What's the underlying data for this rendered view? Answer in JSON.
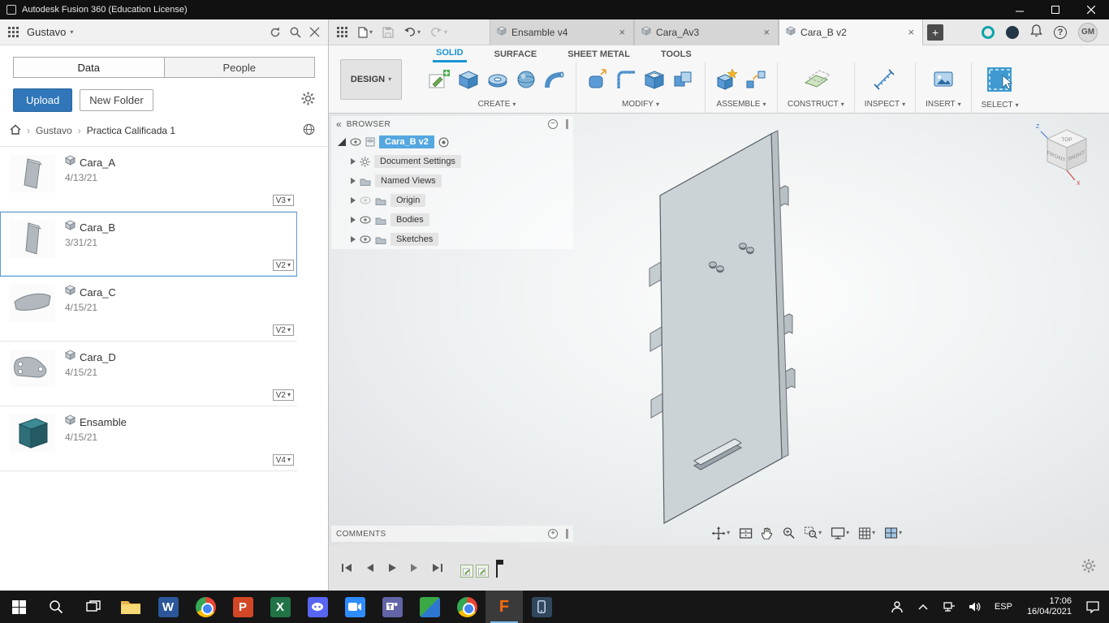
{
  "icons": {
    "caret_down": "▾",
    "close": "×",
    "plus": "+",
    "minus": "−",
    "breadcrumb_sep": "›",
    "collapse": "«",
    "help": "?"
  },
  "colors": {
    "accent_blue": "#1a94d4",
    "selection_blue": "#5b9bd5",
    "upload_blue": "#3076b8",
    "fusion_orange": "#ff6b0b"
  },
  "titlebar": {
    "title": "Autodesk Fusion 360 (Education License)"
  },
  "data_panel": {
    "account": "Gustavo",
    "tabs": [
      "Data",
      "People"
    ],
    "upload_label": "Upload",
    "new_folder_label": "New Folder",
    "breadcrumb": [
      "Gustavo",
      "Practica Calificada 1"
    ],
    "items": [
      {
        "name": "Cara_A",
        "date": "4/13/21",
        "version": "V3"
      },
      {
        "name": "Cara_B",
        "date": "3/31/21",
        "version": "V2"
      },
      {
        "name": "Cara_C",
        "date": "4/15/21",
        "version": "V2"
      },
      {
        "name": "Cara_D",
        "date": "4/15/21",
        "version": "V2"
      },
      {
        "name": "Ensamble",
        "date": "4/15/21",
        "version": "V4"
      }
    ]
  },
  "topbar": {
    "new_tab": "+",
    "avatar": "GM",
    "tabs": [
      {
        "label": "Ensamble v4"
      },
      {
        "label": "Cara_Av3"
      },
      {
        "label": "Cara_B v2"
      }
    ]
  },
  "ribbon": {
    "design_label": "DESIGN",
    "tabs": [
      "SOLID",
      "SURFACE",
      "SHEET METAL",
      "TOOLS"
    ],
    "groups": [
      "CREATE",
      "MODIFY",
      "ASSEMBLE",
      "CONSTRUCT",
      "INSPECT",
      "INSERT",
      "SELECT"
    ]
  },
  "browser": {
    "header": "BROWSER",
    "root_label": "Cara_B v2",
    "items": [
      "Document Settings",
      "Named Views",
      "Origin",
      "Bodies",
      "Sketches"
    ]
  },
  "comments": {
    "header": "COMMENTS"
  },
  "viewcube": {
    "top": "TOP",
    "front": "FRONT",
    "right": "RIGHT",
    "axis_z": "Z",
    "axis_x": "X"
  },
  "taskbar": {
    "language": "ESP",
    "time": "17:06",
    "date": "16/04/2021",
    "apps": {
      "word": "W",
      "powerpoint": "P",
      "excel": "X",
      "fusion": "F"
    }
  }
}
